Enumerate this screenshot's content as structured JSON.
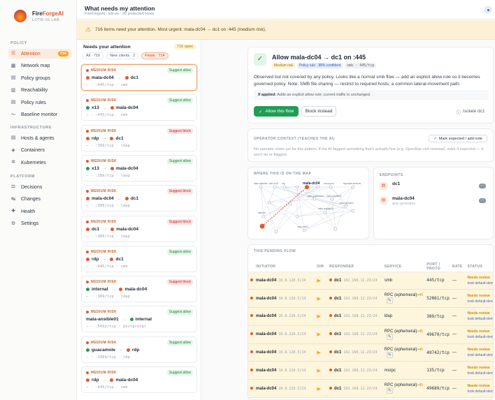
{
  "brand": {
    "name_a": "Fire",
    "name_b": "ForgeAI",
    "sub": "LOTR-16 LAB"
  },
  "sidebar": {
    "sections": [
      {
        "label": "POLICY",
        "items": [
          {
            "label": "Attention",
            "icon": "list-icon",
            "count": "716",
            "active": true
          },
          {
            "label": "Network map",
            "icon": "map-icon"
          },
          {
            "label": "Policy groups",
            "icon": "groups-icon"
          },
          {
            "label": "Reachability",
            "icon": "grid-icon"
          },
          {
            "label": "Policy rules",
            "icon": "rules-icon"
          },
          {
            "label": "Baseline monitor",
            "icon": "pulse-icon"
          }
        ]
      },
      {
        "label": "INFRASTRUCTURE",
        "items": [
          {
            "label": "Hosts & agents",
            "icon": "server-icon"
          },
          {
            "label": "Containers",
            "icon": "cube-icon"
          },
          {
            "label": "Kubernetes",
            "icon": "cluster-icon"
          }
        ]
      },
      {
        "label": "PLATFORM",
        "items": [
          {
            "label": "Decisions",
            "icon": "decisions-icon"
          },
          {
            "label": "Changes",
            "icon": "changes-icon"
          },
          {
            "label": "Health",
            "icon": "health-icon"
          },
          {
            "label": "Settings",
            "icon": "gear-icon"
          }
        ]
      }
    ]
  },
  "header": {
    "title": "What needs my attention",
    "subtitle": "FireForgeAI · lotr-se · 30 protected hosts"
  },
  "banner": {
    "text": "716 items need your attention. Most urgent: mala-dc04 → dc1 on :445 (medium risk)."
  },
  "queue": {
    "title": "Needs your attention",
    "open_badge": "716 open",
    "filters": [
      {
        "label": "All · 716"
      },
      {
        "label": "New clients · 2"
      },
      {
        "label": "Flows · 714",
        "on": true
      }
    ],
    "items": [
      {
        "risk": "MEDIUM RISK",
        "suggestion": "Suggest allow",
        "kind": "allow",
        "src": "mala-dc04",
        "src_color": "#e4572e",
        "dst": "dc1",
        "dst_color": "#e4572e",
        "port": "— · :445/tcp · smb",
        "selected": true
      },
      {
        "risk": "MEDIUM RISK",
        "suggestion": "Suggest allow",
        "kind": "allow",
        "src": "x13",
        "src_color": "#1f9d55",
        "dst": "mala-dc04",
        "dst_color": "#e4572e",
        "port": "— · :445/tcp · smb"
      },
      {
        "risk": "MEDIUM RISK",
        "suggestion": "Suggest block",
        "kind": "block",
        "src": "rdp",
        "src_color": "#e4572e",
        "dst": "dc1",
        "dst_color": "#e4572e",
        "port": "— · :389/tcp · ldap"
      },
      {
        "risk": "MEDIUM RISK",
        "suggestion": "Suggest allow",
        "kind": "allow",
        "src": "x13",
        "src_color": "#1f9d55",
        "dst": "mala-dc04",
        "dst_color": "#e4572e",
        "port": "— · :389/tcp · ldap"
      },
      {
        "risk": "MEDIUM RISK",
        "suggestion": "Suggest block",
        "kind": "block",
        "src": "mala-dc04",
        "src_color": "#e4572e",
        "dst": "dc1",
        "dst_color": "#e4572e",
        "port": "— · :389/tcp · ldap"
      },
      {
        "risk": "MEDIUM RISK",
        "suggestion": "Suggest block",
        "kind": "block",
        "src": "dc1",
        "src_color": "#e4572e",
        "dst": "mala-dc04",
        "dst_color": "#e4572e",
        "port": "— · :389/tcp · ldap"
      },
      {
        "risk": "MEDIUM RISK",
        "suggestion": "Suggest allow",
        "kind": "allow",
        "src": "rdp",
        "src_color": "#e4572e",
        "dst": "dc1",
        "dst_color": "#e4572e",
        "port": "— · :445/tcp · smb"
      },
      {
        "risk": "MEDIUM RISK",
        "suggestion": "Suggest block",
        "kind": "block",
        "src": "internal",
        "src_color": "#1f9d55",
        "dst": "mala-dc04",
        "dst_color": "#e4572e",
        "port": "— · :389/tcp · ldap"
      },
      {
        "risk": "MEDIUM RISK",
        "suggestion": "Suggest allow",
        "kind": "allow",
        "src": "mala-ansible01",
        "src_color": "#1f9d55",
        "dst": "internal",
        "dst_color": "#1f9d55",
        "port": "— · :5432/tcp · postgresql",
        "nosrcdot": true
      },
      {
        "risk": "MEDIUM RISK",
        "suggestion": "Suggest allow",
        "kind": "allow",
        "src": "guacamole",
        "src_color": "#1f9d55",
        "dst": "rdp",
        "dst_color": "#e4572e",
        "port": "— · :3389/tcp · rdp"
      },
      {
        "risk": "MEDIUM RISK",
        "suggestion": "Suggest allow",
        "kind": "allow",
        "src": "rdp",
        "src_color": "#e4572e",
        "dst": "mala-dc04",
        "dst_color": "#e4572e",
        "port": "— · :445/tcp · smb"
      }
    ]
  },
  "detail": {
    "title": "Allow mala-dc04 → dc1 on :445",
    "tags": {
      "medium": "Medium risk",
      "policy": "Policy rule · 88% confident",
      "proto": "smb · 445/tcp"
    },
    "description": "Observed but not covered by any policy. Looks like a normal smb flow — add an explicit allow rule so it becomes governed policy. Note: SMB file sharing — restrict to required hosts; a common lateral-movement path.",
    "applied_label": "If applied:",
    "applied_text": "Adds an explicit allow rule; current traffic is unchanged.",
    "allow_btn": "Allow this flow",
    "block_btn": "Block instead",
    "isolate_btn": "Isolate dc1"
  },
  "operator": {
    "label": "OPERATOR CONTEXT (TEACHES THE AI)",
    "mark_btn": "Mark expected / add note",
    "text": "No operator notes yet for this pattern. If the AI flagged something that's actually fine (e.g. OpenBao cert renewal), mark it expected — it won't be re-flagged."
  },
  "map": {
    "label": "WHERE THIS IS ON THE MAP",
    "dst_node": "mala-dc04",
    "top_labels": [
      "data-loadwise",
      "fhirr-sc01",
      "rdp",
      "cloud-prox",
      "separate-services"
    ],
    "mid_labels": [
      "mala-graphana01",
      "mala-ansible01",
      "mala-ansible02",
      "mala-hecker01"
    ],
    "low_labels": [
      "internal",
      "mala-nfs01"
    ]
  },
  "endpoints": {
    "label": "ENDPOINTS",
    "items": [
      {
        "name": "dc1",
        "sub": "—",
        "icon": "server-icon"
      },
      {
        "name": "mala-dc04",
        "sub": "any-process",
        "icon": "server-icon"
      }
    ]
  },
  "pending": {
    "label": "THIS PENDING FLOW",
    "headers": [
      "INITIATOR",
      "DIR",
      "RESPONDER",
      "SERVICE",
      "PORT / PROTO",
      "RATE",
      "STATUS"
    ],
    "rows": [
      {
        "src": "mala-dc04",
        "sip": "10.8.128.5/24",
        "dst": "dc1",
        "dip": "192.168.12.23/24",
        "svc": "smb",
        "eph": "",
        "port": "445/tcp",
        "rate": "—",
        "st": "Needs review",
        "st2": "took default-deny",
        "edit": false
      },
      {
        "src": "mala-dc04",
        "sip": "10.8.128.5/24",
        "dst": "dc1",
        "dip": "192.168.12.23/24",
        "svc": "RPC (ephemeral)",
        "eph": "+45",
        "port": "52861/tcp",
        "rate": "—",
        "st": "Needs review",
        "st2": "took default-deny",
        "edit": true
      },
      {
        "src": "mala-dc04",
        "sip": "10.8.128.5/24",
        "dst": "dc1",
        "dip": "192.168.12.23/24",
        "svc": "ldap",
        "eph": "",
        "port": "389/tcp",
        "rate": "—",
        "st": "Needs review",
        "st2": "took default-deny",
        "edit": false
      },
      {
        "src": "mala-dc04",
        "sip": "10.8.128.5/24",
        "dst": "dc1",
        "dip": "192.168.12.23/24",
        "svc": "RPC (ephemeral)",
        "eph": "+45",
        "port": "49670/tcp",
        "rate": "—",
        "st": "Needs review",
        "st2": "took default-deny",
        "edit": true
      },
      {
        "src": "mala-dc04",
        "sip": "10.8.128.5/24",
        "dst": "dc1",
        "dip": "192.168.12.23/24",
        "svc": "RPC (ephemeral)",
        "eph": "+45",
        "port": "49742/tcp",
        "rate": "—",
        "st": "Needs review",
        "st2": "took default-deny",
        "edit": true
      },
      {
        "src": "mala-dc04",
        "sip": "10.8.128.5/24",
        "dst": "dc1",
        "dip": "192.168.12.23/24",
        "svc": "msrpc",
        "eph": "",
        "port": "135/tcp",
        "rate": "—",
        "st": "Needs review",
        "st2": "took default-deny",
        "edit": false
      },
      {
        "src": "mala-dc04",
        "sip": "10.8.128.5/24",
        "dst": "dc1",
        "dip": "192.168.12.23/24",
        "svc": "RPC (ephemeral)",
        "eph": "+45",
        "port": "49689/tcp",
        "rate": "—",
        "st": "Needs review",
        "st2": "took default-deny",
        "edit": true
      }
    ]
  }
}
